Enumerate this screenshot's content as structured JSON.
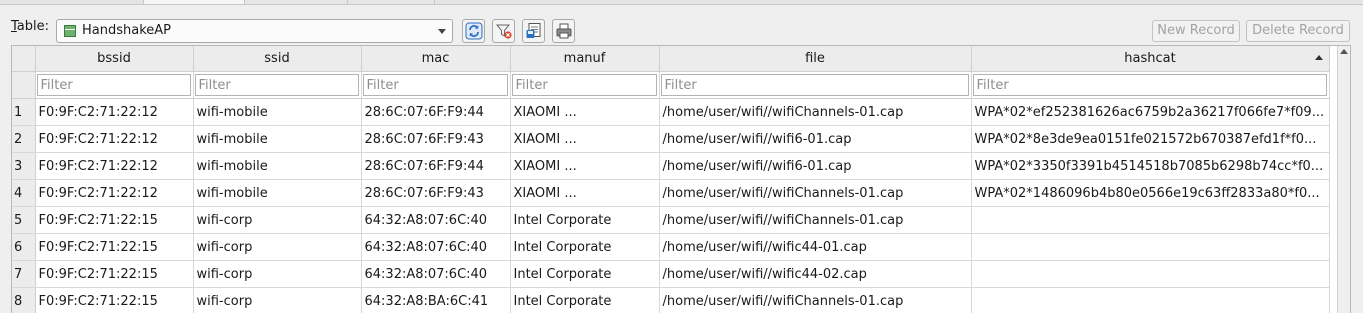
{
  "toolbar": {
    "table_label_accel": "T",
    "table_label_rest": "able:",
    "table_select_value": "HandshakeAP",
    "new_record_label": "New Record",
    "delete_record_label": "Delete Record"
  },
  "columns": [
    "bssid",
    "ssid",
    "mac",
    "manuf",
    "file",
    "hashcat"
  ],
  "sorted_column": "hashcat",
  "filter_placeholder": "Filter",
  "rows": [
    {
      "num": "1",
      "bssid": "F0:9F:C2:71:22:12",
      "ssid": "wifi-mobile",
      "mac": "28:6C:07:6F:F9:44",
      "manuf": "XIAOMI ...",
      "file": "/home/user/wifi//wifiChannels-01.cap",
      "hashcat": "WPA*02*ef252381626ac6759b2a36217f066fe7*f09..."
    },
    {
      "num": "2",
      "bssid": "F0:9F:C2:71:22:12",
      "ssid": "wifi-mobile",
      "mac": "28:6C:07:6F:F9:43",
      "manuf": "XIAOMI ...",
      "file": "/home/user/wifi//wifi6-01.cap",
      "hashcat": "WPA*02*8e3de9ea0151fe021572b670387efd1f*f0..."
    },
    {
      "num": "3",
      "bssid": "F0:9F:C2:71:22:12",
      "ssid": "wifi-mobile",
      "mac": "28:6C:07:6F:F9:44",
      "manuf": "XIAOMI ...",
      "file": "/home/user/wifi//wifi6-01.cap",
      "hashcat": "WPA*02*3350f3391b4514518b7085b6298b74cc*f0..."
    },
    {
      "num": "4",
      "bssid": "F0:9F:C2:71:22:12",
      "ssid": "wifi-mobile",
      "mac": "28:6C:07:6F:F9:43",
      "manuf": "XIAOMI ...",
      "file": "/home/user/wifi//wifiChannels-01.cap",
      "hashcat": "WPA*02*1486096b4b80e0566e19c63ff2833a80*f0..."
    },
    {
      "num": "5",
      "bssid": "F0:9F:C2:71:22:15",
      "ssid": "wifi-corp",
      "mac": "64:32:A8:07:6C:40",
      "manuf": "Intel Corporate",
      "file": "/home/user/wifi//wifiChannels-01.cap",
      "hashcat": ""
    },
    {
      "num": "6",
      "bssid": "F0:9F:C2:71:22:15",
      "ssid": "wifi-corp",
      "mac": "64:32:A8:07:6C:40",
      "manuf": "Intel Corporate",
      "file": "/home/user/wifi//wific44-01.cap",
      "hashcat": ""
    },
    {
      "num": "7",
      "bssid": "F0:9F:C2:71:22:15",
      "ssid": "wifi-corp",
      "mac": "64:32:A8:07:6C:40",
      "manuf": "Intel Corporate",
      "file": "/home/user/wifi//wific44-02.cap",
      "hashcat": ""
    },
    {
      "num": "8",
      "bssid": "F0:9F:C2:71:22:15",
      "ssid": "wifi-corp",
      "mac": "64:32:A8:BA:6C:41",
      "manuf": "Intel Corporate",
      "file": "/home/user/wifi//wifiChannels-01.cap",
      "hashcat": ""
    }
  ],
  "icons": {
    "refresh": "refresh-icon",
    "clear_filters": "clear-filters-icon",
    "save_table": "save-table-icon",
    "print": "print-icon"
  },
  "colors": {
    "accent_blue": "#2f6fbf",
    "filter_red": "#d9452c"
  }
}
